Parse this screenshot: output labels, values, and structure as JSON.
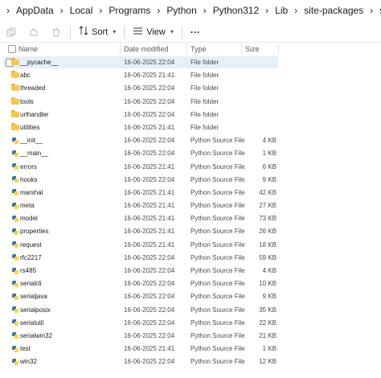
{
  "breadcrumb": [
    "AppData",
    "Local",
    "Programs",
    "Python",
    "Python312",
    "Lib",
    "site-packages",
    "serial"
  ],
  "toolbar": {
    "sort_label": "Sort",
    "view_label": "View",
    "more_label": "···"
  },
  "columns": {
    "name": "Name",
    "date": "Date modified",
    "type": "Type",
    "size": "Size"
  },
  "files": [
    {
      "name": "__pycache__",
      "date": "16-06-2025 22:04",
      "type": "File folder",
      "size": "",
      "icon": "folder-icon",
      "selected": true
    },
    {
      "name": "abc",
      "date": "16-06-2025 21:41",
      "type": "File folder",
      "size": "",
      "icon": "folder-icon"
    },
    {
      "name": "threaded",
      "date": "16-06-2025 22:04",
      "type": "File folder",
      "size": "",
      "icon": "folder-icon"
    },
    {
      "name": "tools",
      "date": "16-06-2025 22:04",
      "type": "File folder",
      "size": "",
      "icon": "folder-icon"
    },
    {
      "name": "urlhandler",
      "date": "16-06-2025 22:04",
      "type": "File folder",
      "size": "",
      "icon": "folder-icon"
    },
    {
      "name": "utilities",
      "date": "16-06-2025 21:41",
      "type": "File folder",
      "size": "",
      "icon": "folder-icon"
    },
    {
      "name": "__init__",
      "date": "16-06-2025 22:04",
      "type": "Python Source File",
      "size": "4 KB",
      "icon": "python-file-icon"
    },
    {
      "name": "__main__",
      "date": "16-06-2025 22:04",
      "type": "Python Source File",
      "size": "1 KB",
      "icon": "python-file-icon"
    },
    {
      "name": "errors",
      "date": "16-06-2025 21:41",
      "type": "Python Source File",
      "size": "6 KB",
      "icon": "python-file-icon"
    },
    {
      "name": "hooks",
      "date": "16-06-2025 22:04",
      "type": "Python Source File",
      "size": "9 KB",
      "icon": "python-file-icon"
    },
    {
      "name": "marshal",
      "date": "16-06-2025 21:41",
      "type": "Python Source File",
      "size": "42 KB",
      "icon": "python-file-icon"
    },
    {
      "name": "meta",
      "date": "16-06-2025 21:41",
      "type": "Python Source File",
      "size": "27 KB",
      "icon": "python-file-icon"
    },
    {
      "name": "model",
      "date": "16-06-2025 21:41",
      "type": "Python Source File",
      "size": "73 KB",
      "icon": "python-file-icon"
    },
    {
      "name": "properties",
      "date": "16-06-2025 21:41",
      "type": "Python Source File",
      "size": "26 KB",
      "icon": "python-file-icon"
    },
    {
      "name": "request",
      "date": "16-06-2025 21:41",
      "type": "Python Source File",
      "size": "18 KB",
      "icon": "python-file-icon"
    },
    {
      "name": "rfc2217",
      "date": "16-06-2025 22:04",
      "type": "Python Source File",
      "size": "59 KB",
      "icon": "python-file-icon"
    },
    {
      "name": "rs485",
      "date": "16-06-2025 22:04",
      "type": "Python Source File",
      "size": "4 KB",
      "icon": "python-file-icon"
    },
    {
      "name": "serialcli",
      "date": "16-06-2025 22:04",
      "type": "Python Source File",
      "size": "10 KB",
      "icon": "python-file-icon"
    },
    {
      "name": "serialjava",
      "date": "16-06-2025 22:04",
      "type": "Python Source File",
      "size": "9 KB",
      "icon": "python-file-icon"
    },
    {
      "name": "serialposix",
      "date": "16-06-2025 22:04",
      "type": "Python Source File",
      "size": "35 KB",
      "icon": "python-file-icon"
    },
    {
      "name": "serialutil",
      "date": "16-06-2025 22:04",
      "type": "Python Source File",
      "size": "22 KB",
      "icon": "python-file-icon"
    },
    {
      "name": "serialwin32",
      "date": "16-06-2025 22:04",
      "type": "Python Source File",
      "size": "21 KB",
      "icon": "python-file-icon"
    },
    {
      "name": "test",
      "date": "16-06-2025 21:41",
      "type": "Python Source File",
      "size": "1 KB",
      "icon": "python-file-icon"
    },
    {
      "name": "win32",
      "date": "16-06-2025 22:04",
      "type": "Python Source File",
      "size": "12 KB",
      "icon": "python-file-icon"
    }
  ],
  "colors": {
    "selection": "#e5eef9",
    "folder": "#f5c84c",
    "python_blue": "#3a75b0",
    "python_yellow": "#ffd43b"
  }
}
